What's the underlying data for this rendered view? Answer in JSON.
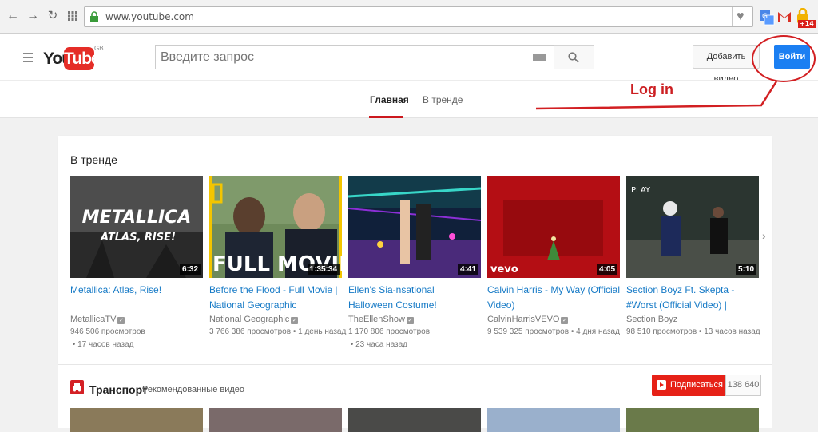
{
  "browser": {
    "url": "www.youtube.com",
    "extension_badge": "+14"
  },
  "youtube": {
    "logo_you": "You",
    "logo_tube": "Tube",
    "region": "GB",
    "search_placeholder": "Введите запрос",
    "upload_label": "Добавить видео",
    "signin_label": "Войти",
    "tabs": [
      {
        "label": "Главная",
        "active": true
      },
      {
        "label": "В тренде",
        "active": false
      }
    ]
  },
  "annotation": {
    "label": "Log in",
    "color": "#d21f22"
  },
  "trending": {
    "title": "В тренде",
    "videos": [
      {
        "title": "Metallica: Atlas, Rise!",
        "channel": "MetallicaTV",
        "views": "946 506 просмотров",
        "age": "17 часов назад",
        "duration": "6:32"
      },
      {
        "title": "Before the Flood - Full Movie | National Geographic",
        "channel": "National Geographic",
        "views": "3 766 386 просмотров",
        "age": "1 день назад",
        "duration": "1:35:34"
      },
      {
        "title": "Ellen's Sia-nsational Halloween Costume!",
        "channel": "TheEllenShow",
        "views": "1 170 806 просмотров",
        "age": "23 часа назад",
        "duration": "4:41"
      },
      {
        "title": "Calvin Harris - My Way (Official Video)",
        "channel": "CalvinHarrisVEVO",
        "views": "9 539 325 просмотров",
        "age": "4 дня назад",
        "duration": "4:05"
      },
      {
        "title": "Section Boyz Ft. Skepta - #Worst (Official Video) | @SectionBoyz…",
        "channel": "Section Boyz",
        "views": "98 510 просмотров",
        "age": "13 часов назад",
        "duration": "5:10"
      }
    ],
    "thumb_texts": {
      "metallica": "METALLICA",
      "metallica_sub": "ATLAS, RISE!",
      "natgeo": "FULL MOVIE",
      "vevo": "vevo",
      "play": "PLAY"
    }
  },
  "channel_shelf": {
    "title": "Транспорт",
    "subtitle": "Рекомендованные видео",
    "subscribe_label": "Подписаться",
    "subscriber_count": "138 640"
  }
}
